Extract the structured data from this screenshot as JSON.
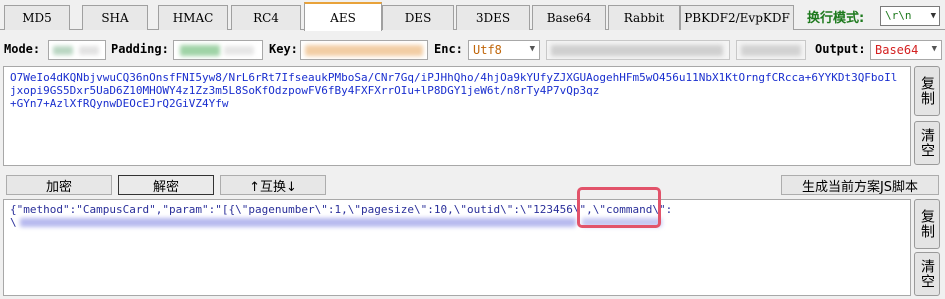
{
  "tabs": [
    {
      "label": "MD5"
    },
    {
      "label": "SHA"
    },
    {
      "label": "HMAC"
    },
    {
      "label": "RC4"
    },
    {
      "label": "AES"
    },
    {
      "label": "DES"
    },
    {
      "label": "3DES"
    },
    {
      "label": "Base64"
    },
    {
      "label": "Rabbit"
    },
    {
      "label": "PBKDF2/EvpKDF"
    }
  ],
  "active_tab": "AES",
  "line_mode": {
    "label": "换行模式:",
    "value": "\\r\\n"
  },
  "options": {
    "mode_label": "Mode:",
    "padding_label": "Padding:",
    "key_label": "Key:",
    "enc_label": "Enc:",
    "enc_value": "Utf8",
    "output_label": "Output:",
    "output_value": "Base64"
  },
  "input_text": "O7WeIo4dKQNbjvwuCQ36nOnsfFNI5yw8/NrL6rRt7IfseaukPMboSa/CNr7Gq/iPJHhQho/4hjOa9kYUfyZJXGUAogehHFm5wO456u11NbX1KtOrngfCRcca+6YYKDt3QFboIljxopi9GS5Dxr5UaD6Z10MHOWY4z1Zz3m5L8SoKfOdzpowFV6fBy4FXFXrrOIu+lP8DGY1jeW6t/n8rTy4P7vQp3qz\n+GYn7+AzlXfRQynwDEOcEJrQ2GiVZ4Yfw",
  "side_buttons": {
    "copy": "复制",
    "clear": "清空"
  },
  "actions": {
    "encrypt": "加密",
    "decrypt": "解密",
    "swap": "↑互换↓",
    "generate": "生成当前方案JS脚本"
  },
  "output_text_line1": "{\"method\":\"CampusCard\",\"param\":\"[{\\\"pagenumber\\\":1,\\\"pagesize\\\":10,\\\"outid\\\":\\\"123456\\\",\\\"command\\\":",
  "output_text_line2": "\\"
}
